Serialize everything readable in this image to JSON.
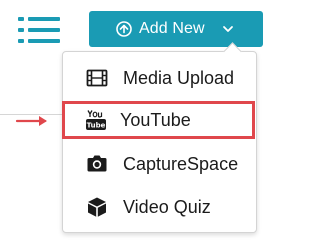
{
  "toolbar": {
    "list_icon": "list-icon",
    "add_new_label": "Add New",
    "add_new_icon": "plus-circle-icon",
    "dropdown_icon": "chevron-down-icon"
  },
  "menu": {
    "items": [
      {
        "label": "Media Upload",
        "icon": "film-icon"
      },
      {
        "label": "YouTube",
        "icon": "youtube-icon",
        "highlighted": true
      },
      {
        "label": "CaptureSpace",
        "icon": "camera-icon"
      },
      {
        "label": "Video Quiz",
        "icon": "cube-icon"
      }
    ]
  },
  "colors": {
    "accent": "#1a9bb4",
    "highlight": "#e0474c"
  }
}
